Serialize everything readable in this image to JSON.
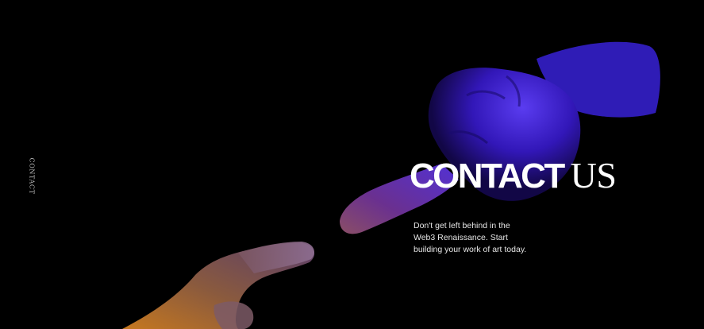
{
  "side_nav": {
    "label": "CONTACT"
  },
  "hero": {
    "headline_primary": "CONTACT",
    "headline_secondary": "US",
    "tagline": "Don't get left behind in the Web3 Renaissance. Start building your work of art today."
  },
  "colors": {
    "background": "#000000",
    "upper_hand": "#3a20c8",
    "lower_hand": "#c07a3a",
    "text": "#ffffff"
  }
}
